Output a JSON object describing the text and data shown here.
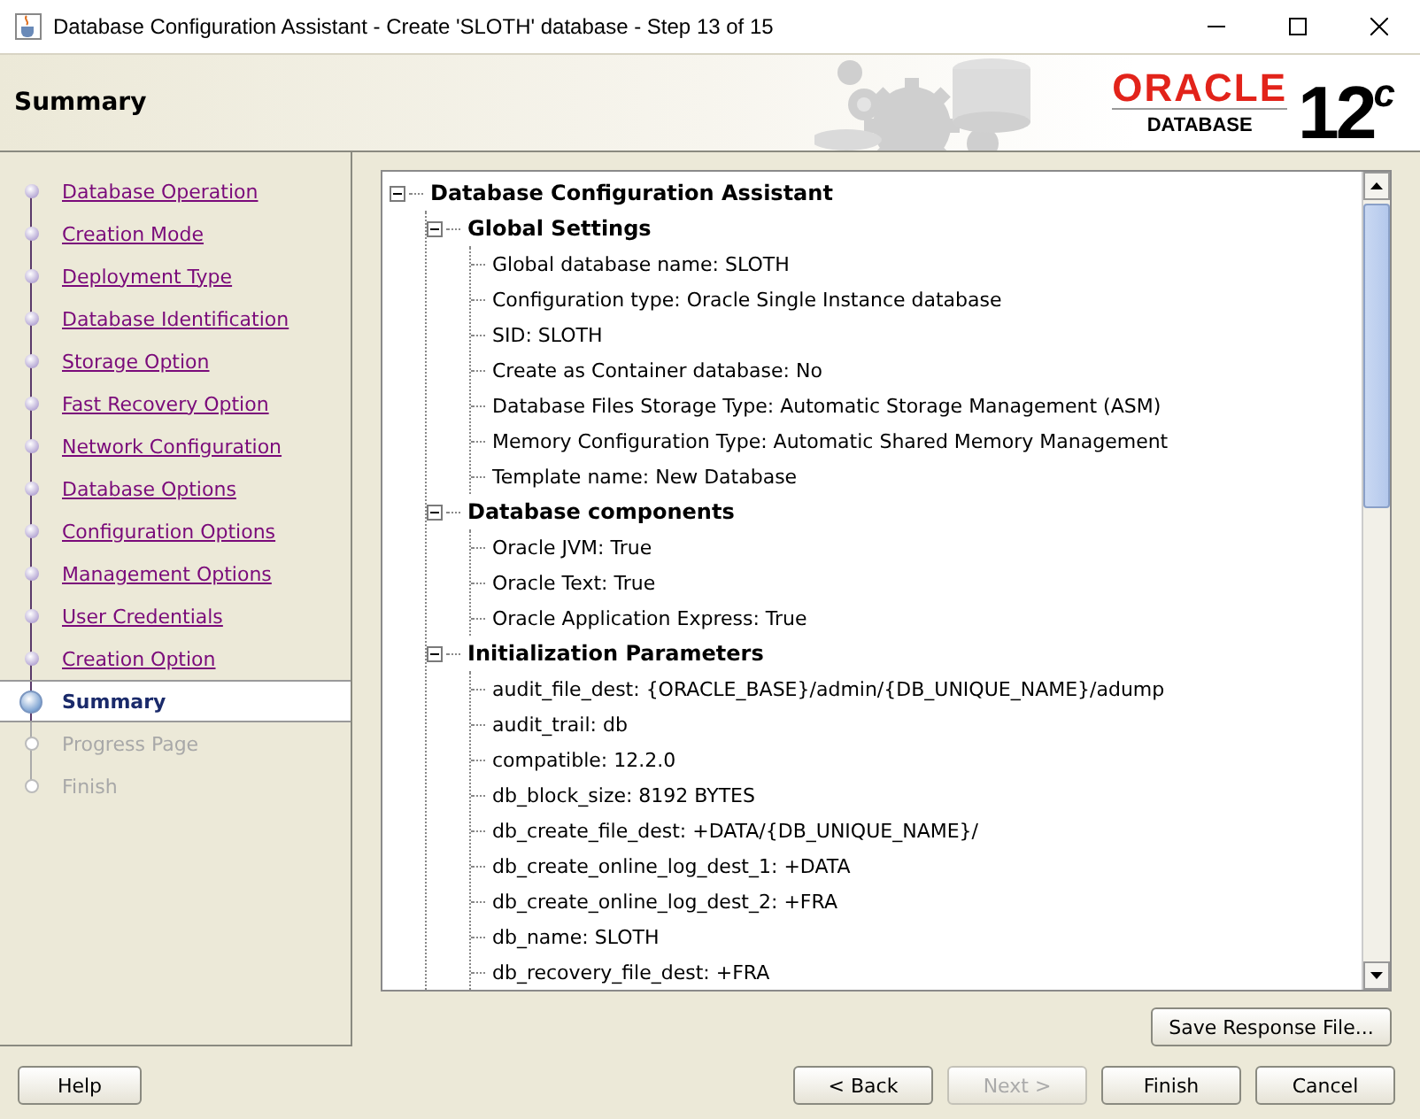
{
  "window": {
    "title": "Database Configuration Assistant - Create 'SLOTH' database - Step 13 of 15"
  },
  "header": {
    "title": "Summary",
    "logo": {
      "brand": "ORACLE",
      "product": "DATABASE",
      "version": "12$^{c}$"
    }
  },
  "steps": [
    {
      "label": "Database Operation",
      "kind": "visited",
      "selected": false
    },
    {
      "label": "Creation Mode",
      "kind": "visited",
      "selected": false
    },
    {
      "label": "Deployment Type",
      "kind": "visited",
      "selected": false
    },
    {
      "label": "Database Identification",
      "kind": "visited",
      "selected": false
    },
    {
      "label": "Storage Option",
      "kind": "visited",
      "selected": false
    },
    {
      "label": "Fast Recovery Option",
      "kind": "visited",
      "selected": false
    },
    {
      "label": "Network Configuration",
      "kind": "visited",
      "selected": false
    },
    {
      "label": "Database Options",
      "kind": "visited",
      "selected": false
    },
    {
      "label": "Configuration Options",
      "kind": "visited",
      "selected": false
    },
    {
      "label": "Management Options",
      "kind": "visited",
      "selected": false
    },
    {
      "label": "User Credentials",
      "kind": "visited",
      "selected": false
    },
    {
      "label": "Creation Option",
      "kind": "visited",
      "selected": false
    },
    {
      "label": "Summary",
      "kind": "current",
      "selected": true
    },
    {
      "label": "Progress Page",
      "kind": "pending",
      "selected": false
    },
    {
      "label": "Finish",
      "kind": "pending",
      "selected": false
    }
  ],
  "tree": {
    "label": "Database Configuration Assistant",
    "expanded": true,
    "children": [
      {
        "label": "Global Settings",
        "expanded": true,
        "children": [
          {
            "label": "Global database name: SLOTH"
          },
          {
            "label": "Configuration type: Oracle Single Instance database"
          },
          {
            "label": "SID: SLOTH"
          },
          {
            "label": "Create as Container database: No"
          },
          {
            "label": "Database Files Storage Type: Automatic Storage Management (ASM)"
          },
          {
            "label": "Memory Configuration Type: Automatic Shared Memory Management"
          },
          {
            "label": "Template name: New Database"
          }
        ]
      },
      {
        "label": "Database components",
        "expanded": true,
        "children": [
          {
            "label": "Oracle JVM: True"
          },
          {
            "label": "Oracle Text: True"
          },
          {
            "label": "Oracle Application Express: True"
          }
        ]
      },
      {
        "label": "Initialization Parameters",
        "expanded": true,
        "children": [
          {
            "label": "audit_file_dest: {ORACLE_BASE}/admin/{DB_UNIQUE_NAME}/adump"
          },
          {
            "label": "audit_trail: db"
          },
          {
            "label": "compatible: 12.2.0"
          },
          {
            "label": "db_block_size: 8192 BYTES"
          },
          {
            "label": "db_create_file_dest: +DATA/{DB_UNIQUE_NAME}/"
          },
          {
            "label": "db_create_online_log_dest_1: +DATA"
          },
          {
            "label": "db_create_online_log_dest_2: +FRA"
          },
          {
            "label": "db_name: SLOTH"
          },
          {
            "label": "db_recovery_file_dest: +FRA"
          }
        ]
      }
    ]
  },
  "save_button": {
    "label": "Save Response File...",
    "disabled": false
  },
  "buttons": [
    {
      "label": "Help",
      "disabled": false,
      "kind": "left"
    },
    {
      "label": "< Back",
      "disabled": false,
      "kind": "right"
    },
    {
      "label": "Next >",
      "disabled": true,
      "kind": "right"
    },
    {
      "label": "Finish",
      "disabled": false,
      "kind": "right"
    },
    {
      "label": "Cancel",
      "disabled": false,
      "kind": "right"
    }
  ]
}
